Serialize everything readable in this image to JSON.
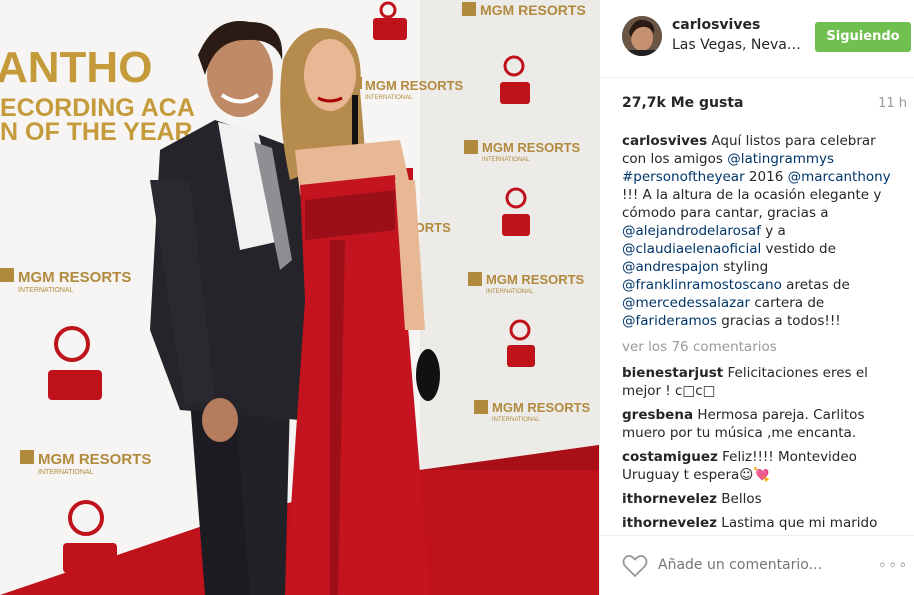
{
  "colors": {
    "follow_green": "#70c050",
    "link_blue": "#003569",
    "muted_gray": "#999999",
    "carpet_red": "#c0121b"
  },
  "photo": {
    "backdrop": {
      "anthony_text": "ANTHO",
      "recording_text": "ECORDING ACA",
      "year_text": "N OF THE YEAR",
      "mgm": "MGM RESORTS",
      "mgm_sub": "INTERNATIONAL",
      "sorts_text": "SORTS"
    }
  },
  "header": {
    "username": "carlosvives",
    "location": "Las Vegas, Neva…",
    "follow_label": "Siguiendo"
  },
  "stats": {
    "likes": "27,7k Me gusta",
    "time": "11 h"
  },
  "caption": {
    "user": "carlosvives",
    "parts": [
      {
        "t": " Aquí listos para celebrar con los amigos ",
        "link": false
      },
      {
        "t": "@latingrammys",
        "link": true
      },
      {
        "t": " ",
        "link": false
      },
      {
        "t": "#personoftheyear",
        "link": true
      },
      {
        "t": " 2016 ",
        "link": false
      },
      {
        "t": "@marcanthony",
        "link": true
      },
      {
        "t": " !!! A la altura de la ocasión elegante y cómodo para cantar, gracias a ",
        "link": false
      },
      {
        "t": "@alejandrodelarosaf",
        "link": true
      },
      {
        "t": " y a ",
        "link": false
      },
      {
        "t": "@claudiaelenaoficial",
        "link": true
      },
      {
        "t": " vestido de ",
        "link": false
      },
      {
        "t": "@andrespajon",
        "link": true
      },
      {
        "t": " styling ",
        "link": false
      },
      {
        "t": "@franklinramostoscano",
        "link": true
      },
      {
        "t": " aretas de ",
        "link": false
      },
      {
        "t": "@mercedessalazar",
        "link": true
      },
      {
        "t": " cartera de ",
        "link": false
      },
      {
        "t": "@farideramos",
        "link": true
      },
      {
        "t": " gracias a todos!!!",
        "link": false
      }
    ]
  },
  "view_all": "ver los 76 comentarios",
  "comments": [
    {
      "user": "bienestarjust",
      "text": "Felicitaciones eres el mejor ! c□c□"
    },
    {
      "user": "gresbena",
      "text": "Hermosa pareja. Carlitos muero por tu música ,me encanta."
    },
    {
      "user": "costamiguez",
      "text": "Feliz!!!! Montevideo Uruguay t espera☺💘"
    },
    {
      "user": "ithornevelez",
      "text": "Bellos"
    },
    {
      "user": "ithornevelez",
      "text": "Lastima que mi marido no"
    }
  ],
  "footer": {
    "add_comment_placeholder": "Añade un comentario...",
    "heart_icon": "heart-outline-icon",
    "more_icon": "more-dots-icon",
    "more_label": "◦◦◦"
  }
}
